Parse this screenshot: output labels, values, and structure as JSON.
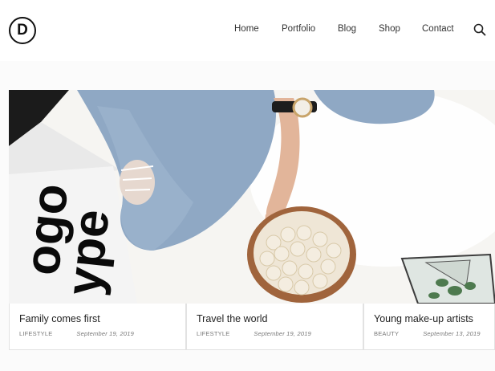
{
  "brand": {
    "logo_letter": "D"
  },
  "nav": {
    "items": [
      {
        "label": "Home"
      },
      {
        "label": "Portfolio"
      },
      {
        "label": "Blog"
      },
      {
        "label": "Shop"
      },
      {
        "label": "Contact"
      }
    ],
    "search_icon": "search-icon"
  },
  "hero": {
    "magazine_text_line1": "ogo",
    "magazine_text_line2": "ype",
    "colors": {
      "denim": "#8fa8c4",
      "bowl": "#a0643c",
      "popcorn": "#f4ede0",
      "rug": "#f6f5f2"
    }
  },
  "posts": [
    {
      "title": "Family comes first",
      "category": "LIFESTYLE",
      "date": "September 19, 2019"
    },
    {
      "title": "Travel the world",
      "category": "LIFESTYLE",
      "date": "September 19, 2019"
    },
    {
      "title": "Young make-up artists",
      "category": "BEAUTY",
      "date": "September 13, 2019"
    }
  ]
}
